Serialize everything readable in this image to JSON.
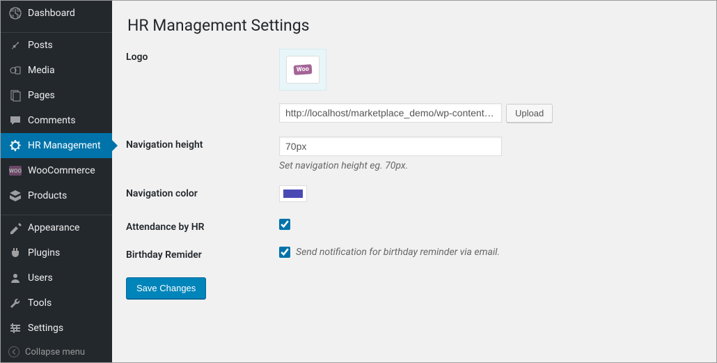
{
  "sidebar": {
    "items": [
      {
        "label": "Dashboard"
      },
      {
        "label": "Posts"
      },
      {
        "label": "Media"
      },
      {
        "label": "Pages"
      },
      {
        "label": "Comments"
      },
      {
        "label": "HR Management"
      },
      {
        "label": "WooCommerce"
      },
      {
        "label": "Products"
      },
      {
        "label": "Appearance"
      },
      {
        "label": "Plugins"
      },
      {
        "label": "Users"
      },
      {
        "label": "Tools"
      },
      {
        "label": "Settings"
      }
    ],
    "collapse_label": "Collapse menu"
  },
  "page": {
    "title": "HR Management Settings",
    "logo": {
      "label": "Logo",
      "url": "http://localhost/marketplace_demo/wp-content/uploads",
      "upload_label": "Upload"
    },
    "nav_height": {
      "label": "Navigation height",
      "value": "70px",
      "desc": "Set navigation height eg. 70px."
    },
    "nav_color": {
      "label": "Navigation color",
      "value": "#4a4ab5"
    },
    "attendance": {
      "label": "Attendance by HR",
      "checked": true
    },
    "birthday": {
      "label": "Birthday Remider",
      "checked": true,
      "desc": "Send notification for birthday reminder via email."
    },
    "save_label": "Save Changes"
  }
}
